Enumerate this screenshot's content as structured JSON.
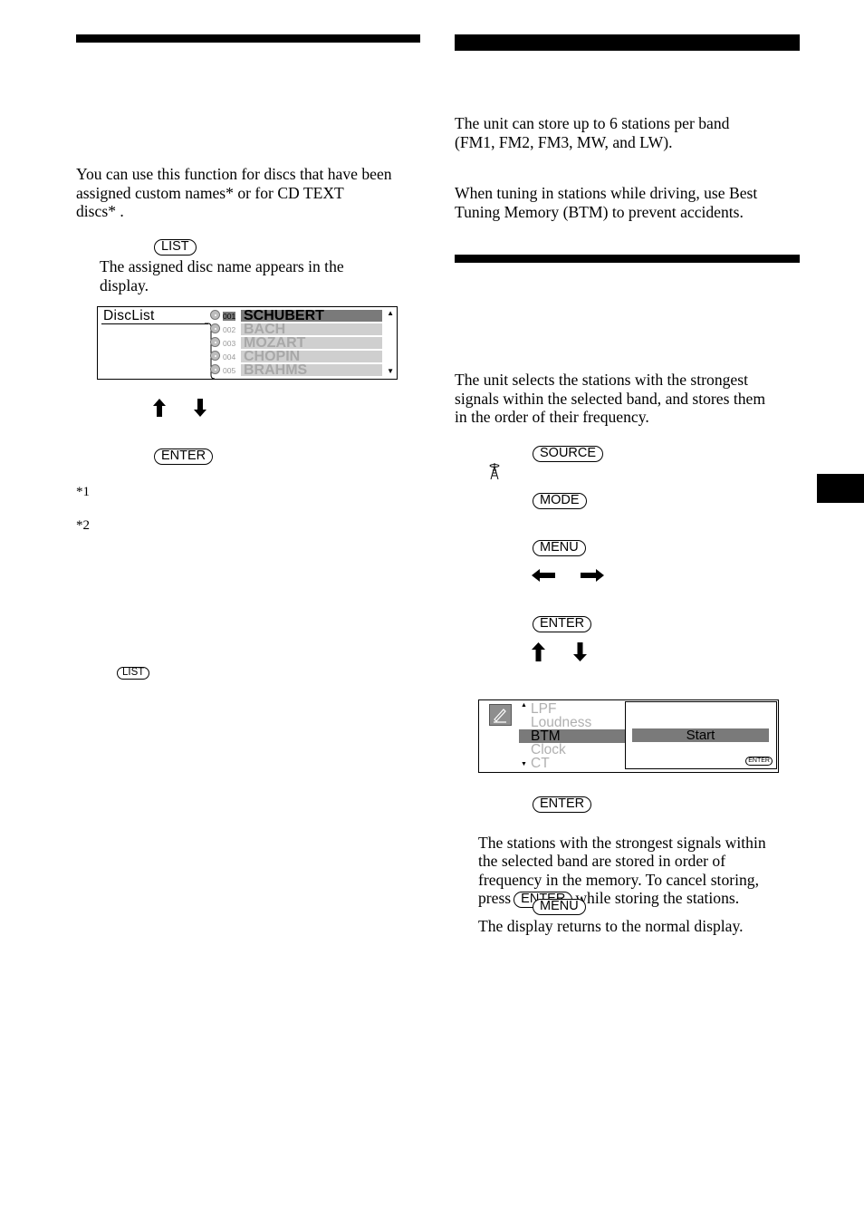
{
  "left_column": {
    "intro_text": "You can use this function for discs that have been\nassigned custom names*   or for CD TEXT\ndiscs* .",
    "step1": {
      "button": "LIST",
      "result": "The assigned disc name appears in the\ndisplay."
    },
    "disc_list_display": {
      "title": "DiscList",
      "entries": [
        {
          "number": "001",
          "name": "SCHUBERT",
          "selected": true
        },
        {
          "number": "002",
          "name": "BACH",
          "selected": false
        },
        {
          "number": "003",
          "name": "MOZART",
          "selected": false
        },
        {
          "number": "004",
          "name": "CHOPIN",
          "selected": false
        },
        {
          "number": "005",
          "name": "BRAHMS",
          "selected": false
        }
      ],
      "scroll_up_icon": "▲",
      "scroll_down_icon": "▼"
    },
    "step2": {
      "arrows": [
        "up-arrow",
        "down-arrow"
      ]
    },
    "step3": {
      "button": "ENTER"
    },
    "footnotes": [
      "*1",
      "*2"
    ],
    "note_button": "LIST"
  },
  "right_column": {
    "intro_text_1": "The unit can store up to 6 stations per band\n(FM1, FM2, FM3, MW, and LW).",
    "intro_text_2": "When tuning in stations while driving, use Best\nTuning Memory (BTM) to prevent accidents.",
    "btm_intro": "The unit selects the stations with the strongest\nsignals within the selected band, and stores them\nin the order of their frequency.",
    "steps": {
      "source_button": "SOURCE",
      "tuner_icon": "antenna-tower-icon",
      "mode_button": "MODE",
      "menu_button": "MENU",
      "left_right_arrows": [
        "left-arrow",
        "right-arrow"
      ],
      "enter_button": "ENTER",
      "up_down_arrows": [
        "up-arrow",
        "down-arrow"
      ]
    },
    "btm_display": {
      "menu_items": [
        {
          "label": "LPF",
          "selected": false
        },
        {
          "label": "Loudness",
          "selected": false
        },
        {
          "label": "BTM",
          "selected": true
        },
        {
          "label": "Clock",
          "selected": false
        },
        {
          "label": "CT",
          "selected": false
        }
      ],
      "action_label": "Start",
      "enter_hint": "ENTER"
    },
    "step_store": {
      "button": "ENTER",
      "text_before": "The stations with the strongest signals within\nthe selected band are stored in order of\nfrequency in the memory. To cancel storing,\npress",
      "inline_button": "ENTER",
      "text_after": "while storing the stations."
    },
    "step_exit": {
      "button": "MENU",
      "text": "The display returns to the normal display."
    }
  }
}
